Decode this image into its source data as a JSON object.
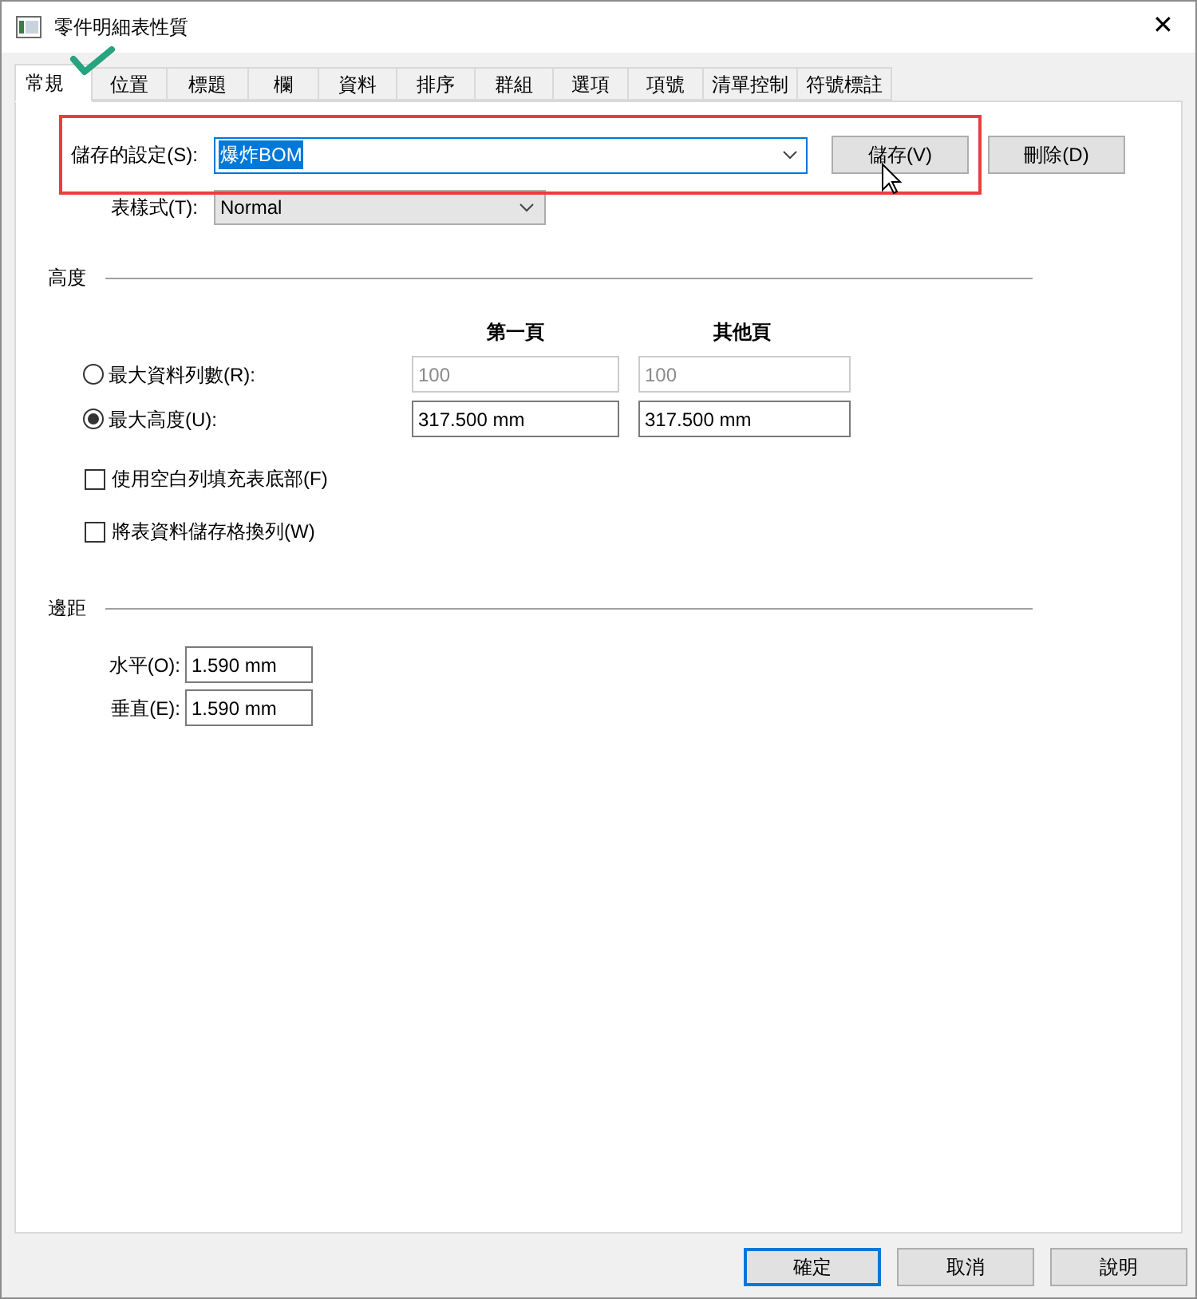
{
  "window": {
    "title": "零件明細表性質",
    "close": "✕"
  },
  "tabs": [
    {
      "label": "常規",
      "selected": true
    },
    {
      "label": "位置",
      "selected": false
    },
    {
      "label": "標題",
      "selected": false
    },
    {
      "label": "欄",
      "selected": false
    },
    {
      "label": "資料",
      "selected": false
    },
    {
      "label": "排序",
      "selected": false
    },
    {
      "label": "群組",
      "selected": false
    },
    {
      "label": "選項",
      "selected": false
    },
    {
      "label": "項號",
      "selected": false
    },
    {
      "label": "清單控制",
      "selected": false
    },
    {
      "label": "符號標註",
      "selected": false
    }
  ],
  "saved_settings": {
    "label": "儲存的設定(S):",
    "value": "爆炸BOM",
    "save_button": "儲存(V)",
    "delete_button": "刪除(D)"
  },
  "table_style": {
    "label": "表樣式(T):",
    "value": "Normal"
  },
  "height_section": {
    "title": "高度",
    "columns": [
      "第一頁",
      "其他頁"
    ],
    "options": [
      {
        "label": "最大資料列數(R):",
        "selected": false,
        "disabled": true,
        "first_page": "100",
        "other_page": "100"
      },
      {
        "label": "最大高度(U):",
        "selected": true,
        "disabled": false,
        "first_page": "317.500 mm",
        "other_page": "317.500 mm"
      }
    ],
    "checkboxes": [
      {
        "label": "使用空白列填充表底部(F)",
        "checked": false
      },
      {
        "label": "將表資料儲存格換列(W)",
        "checked": false
      }
    ]
  },
  "margins": {
    "title": "邊距",
    "fields": [
      {
        "label": "水平(O):",
        "value": "1.590 mm"
      },
      {
        "label": "垂直(E):",
        "value": "1.590 mm"
      }
    ]
  },
  "buttons": [
    {
      "label": "確定",
      "focused": true
    },
    {
      "label": "取消",
      "focused": false
    },
    {
      "label": "說明",
      "focused": false
    }
  ]
}
